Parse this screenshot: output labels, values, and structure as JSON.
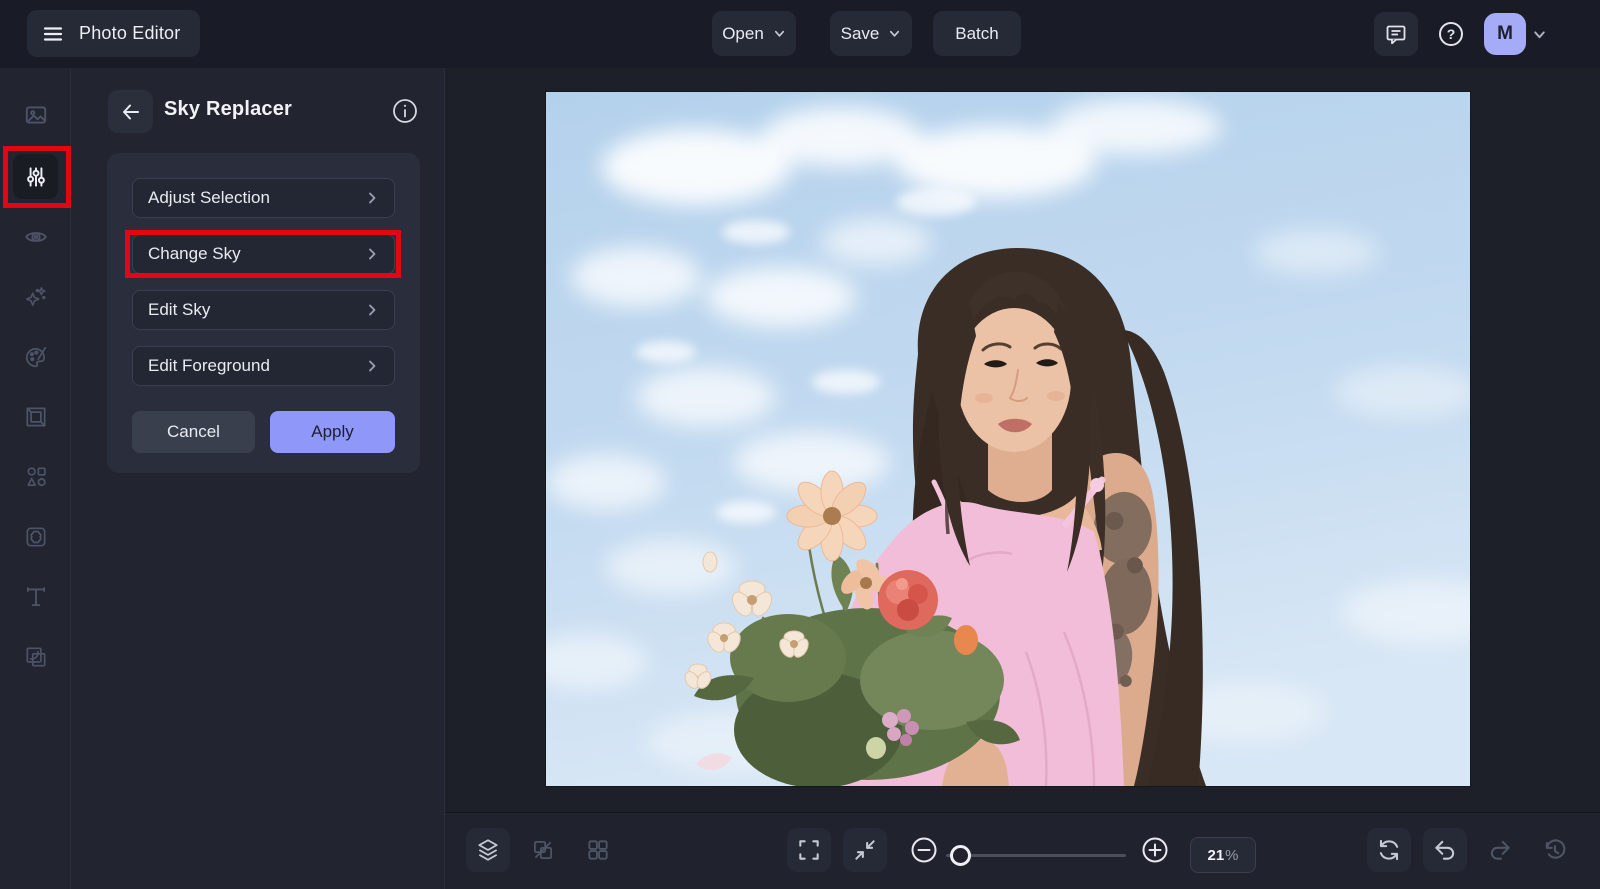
{
  "topbar": {
    "app_title": "Photo Editor",
    "open_label": "Open",
    "save_label": "Save",
    "batch_label": "Batch",
    "help_glyph": "?",
    "avatar_initial": "M"
  },
  "sidebar": {
    "tools": [
      "image",
      "adjustments",
      "eye",
      "effects",
      "paint",
      "frame",
      "shapes",
      "filters",
      "text",
      "arrange"
    ],
    "active_tool": "adjustments"
  },
  "panel": {
    "title": "Sky Replacer",
    "items": [
      {
        "label": "Adjust Selection"
      },
      {
        "label": "Change Sky"
      },
      {
        "label": "Edit Sky"
      },
      {
        "label": "Edit Foreground"
      }
    ],
    "cancel_label": "Cancel",
    "apply_label": "Apply"
  },
  "statusbar": {
    "zoom_value": "21",
    "zoom_unit": "%"
  },
  "canvas": {
    "image_description": "Woman with long dark hair in a pink ruffled dress, arm tattoo, holding a bouquet of peach and coral flowers against a blue sky with white clouds"
  },
  "annotations": {
    "highlight_color": "#e30613",
    "highlighted": [
      "adjustments-tool",
      "change-sky-item"
    ]
  },
  "colors": {
    "accent": "#8f97f8",
    "avatar_bg": "#a6abf7",
    "topbar_bg": "#191c26",
    "panel_bg": "#22252f",
    "canvas_bg": "#1d1f29",
    "sky_blue": "#bcd6ee"
  }
}
